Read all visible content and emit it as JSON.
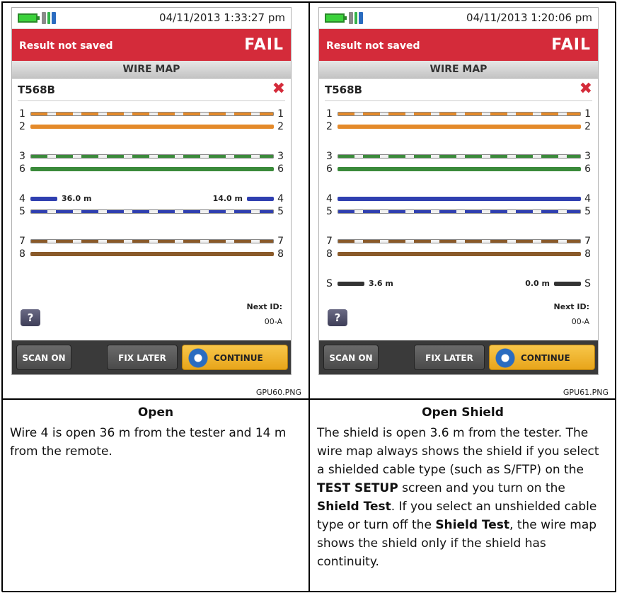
{
  "panels": [
    {
      "datetime": "04/11/2013 1:33:27 pm",
      "result_status": "Result not saved",
      "verdict": "FAIL",
      "screen_title": "WIRE MAP",
      "cable_type": "T568B",
      "fail_icon": "close-icon",
      "wires": [
        {
          "pin": "1",
          "style": "stripe",
          "color": "#e48a2a"
        },
        {
          "pin": "2",
          "style": "solid",
          "color": "#e48a2a"
        },
        {
          "pin": "3",
          "style": "stripe",
          "color": "#3a8a3a"
        },
        {
          "pin": "6",
          "style": "solid",
          "color": "#3a8a3a"
        },
        {
          "pin": "4",
          "style": "open",
          "color": "#2f3fb0",
          "left_distance": "36.0 m",
          "right_distance": "14.0 m"
        },
        {
          "pin": "5",
          "style": "stripe",
          "color": "#2f3fb0"
        },
        {
          "pin": "7",
          "style": "stripe",
          "color": "#8a5a2a"
        },
        {
          "pin": "8",
          "style": "solid",
          "color": "#8a5a2a"
        }
      ],
      "next_id_label": "Next ID:",
      "next_id_value": "00-A",
      "help_label": "?",
      "buttons": {
        "scan": "SCAN ON",
        "fix": "FIX LATER",
        "continue": "CONTINUE"
      },
      "image_label": "GPU60.PNG"
    },
    {
      "datetime": "04/11/2013 1:20:06 pm",
      "result_status": "Result not saved",
      "verdict": "FAIL",
      "screen_title": "WIRE MAP",
      "cable_type": "T568B",
      "fail_icon": "close-icon",
      "wires": [
        {
          "pin": "1",
          "style": "stripe",
          "color": "#e48a2a"
        },
        {
          "pin": "2",
          "style": "solid",
          "color": "#e48a2a"
        },
        {
          "pin": "3",
          "style": "stripe",
          "color": "#3a8a3a"
        },
        {
          "pin": "6",
          "style": "solid",
          "color": "#3a8a3a"
        },
        {
          "pin": "4",
          "style": "solid",
          "color": "#2f3fb0"
        },
        {
          "pin": "5",
          "style": "stripe",
          "color": "#2f3fb0"
        },
        {
          "pin": "7",
          "style": "stripe",
          "color": "#8a5a2a"
        },
        {
          "pin": "8",
          "style": "solid",
          "color": "#8a5a2a"
        },
        {
          "pin": "S",
          "style": "open",
          "color": "#333333",
          "left_distance": "3.6 m",
          "right_distance": "0.0 m"
        }
      ],
      "next_id_label": "Next ID:",
      "next_id_value": "00-A",
      "help_label": "?",
      "buttons": {
        "scan": "SCAN ON",
        "fix": "FIX LATER",
        "continue": "CONTINUE"
      },
      "image_label": "GPU61.PNG"
    }
  ],
  "captions": [
    {
      "heading": "Open",
      "text": "Wire 4 is open 36 m from the tester and 14 m from the remote."
    },
    {
      "heading": "Open Shield",
      "parts": [
        "The shield is open 3.6 m from the tester. The wire map always shows the shield if you select a shielded cable type (such as S/FTP) on the ",
        "TEST SETUP",
        " screen and you turn on the ",
        "Shield Test",
        ". If you select an unshielded cable type or turn off the ",
        "Shield Test",
        ", the wire map shows the shield only if the shield has continuity."
      ]
    }
  ]
}
